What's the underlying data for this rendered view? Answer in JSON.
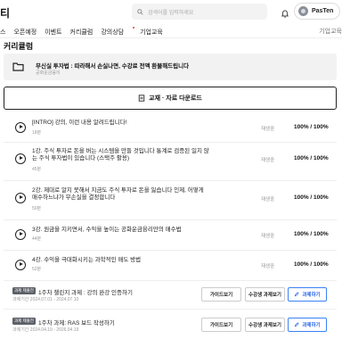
{
  "header": {
    "logo": "티",
    "search_placeholder": "검색어를 입력하세요",
    "user_name": "PasTen"
  },
  "nav": {
    "items": [
      "스",
      "오픈예정",
      "이벤트",
      "커리큘럼",
      "강의상담",
      "기업교육"
    ],
    "right_label": "기업교육"
  },
  "page_title": "커리큘럼",
  "notice": {
    "title": "무신실 투자법 : 따라해서 손실나면, 수강료 전액 환불해드립니다",
    "subtitle": "공화운금융이"
  },
  "download_label": "교재 · 자료 다운로드",
  "lessons": [
    {
      "title": "[INTRO] 강의, 이런 내용 알려드립니다!",
      "duration": "18분",
      "state": "재생중",
      "progress": "100% / 100%"
    },
    {
      "title": "1강. 주식 투자로 돈을 버는 시스템을 만들 것입니다 통계로 검증된 일지 않는 주식 투자법이 있습니다 (스택주 활용)",
      "duration": "45분",
      "state": "재생중",
      "progress": "100% / 100%"
    },
    {
      "title": "2강. 제대로 알지 못해서 지금도 주식 투자로 돈을 잃습니다 인제, 어떻게 매수하느냐가 무손실을 결정합니다",
      "duration": "50분",
      "state": "재생중",
      "progress": "100% / 100%"
    },
    {
      "title": "3강. 원금을 지키면서, 수익을 높이는 공화운금융리만의 매수법",
      "duration": "44분",
      "state": "재생중",
      "progress": "100% / 100%"
    },
    {
      "title": "4강. 수익을 극대화시키는 과학적인 매도 방법",
      "duration": "52분",
      "state": "재생중",
      "progress": "100% / 100%"
    }
  ],
  "assignments": [
    {
      "badge": "과제 제출전",
      "title": "1주차 챌린지 과제 : 강의 완강 인증하기",
      "period": "과제기간 2024.07.01 - 2024.07.10",
      "guide": "가이드보기",
      "status": "수강생 과제보기",
      "submit": "과제하기"
    },
    {
      "badge": "과제 제출전",
      "title": "1주차 과제: RAS 보드 작성하기",
      "period": "과제기간 2024.04.19 - 2026.04.19",
      "guide": "가이드보기",
      "status": "수강생 과제보기",
      "submit": "과제하기"
    }
  ]
}
